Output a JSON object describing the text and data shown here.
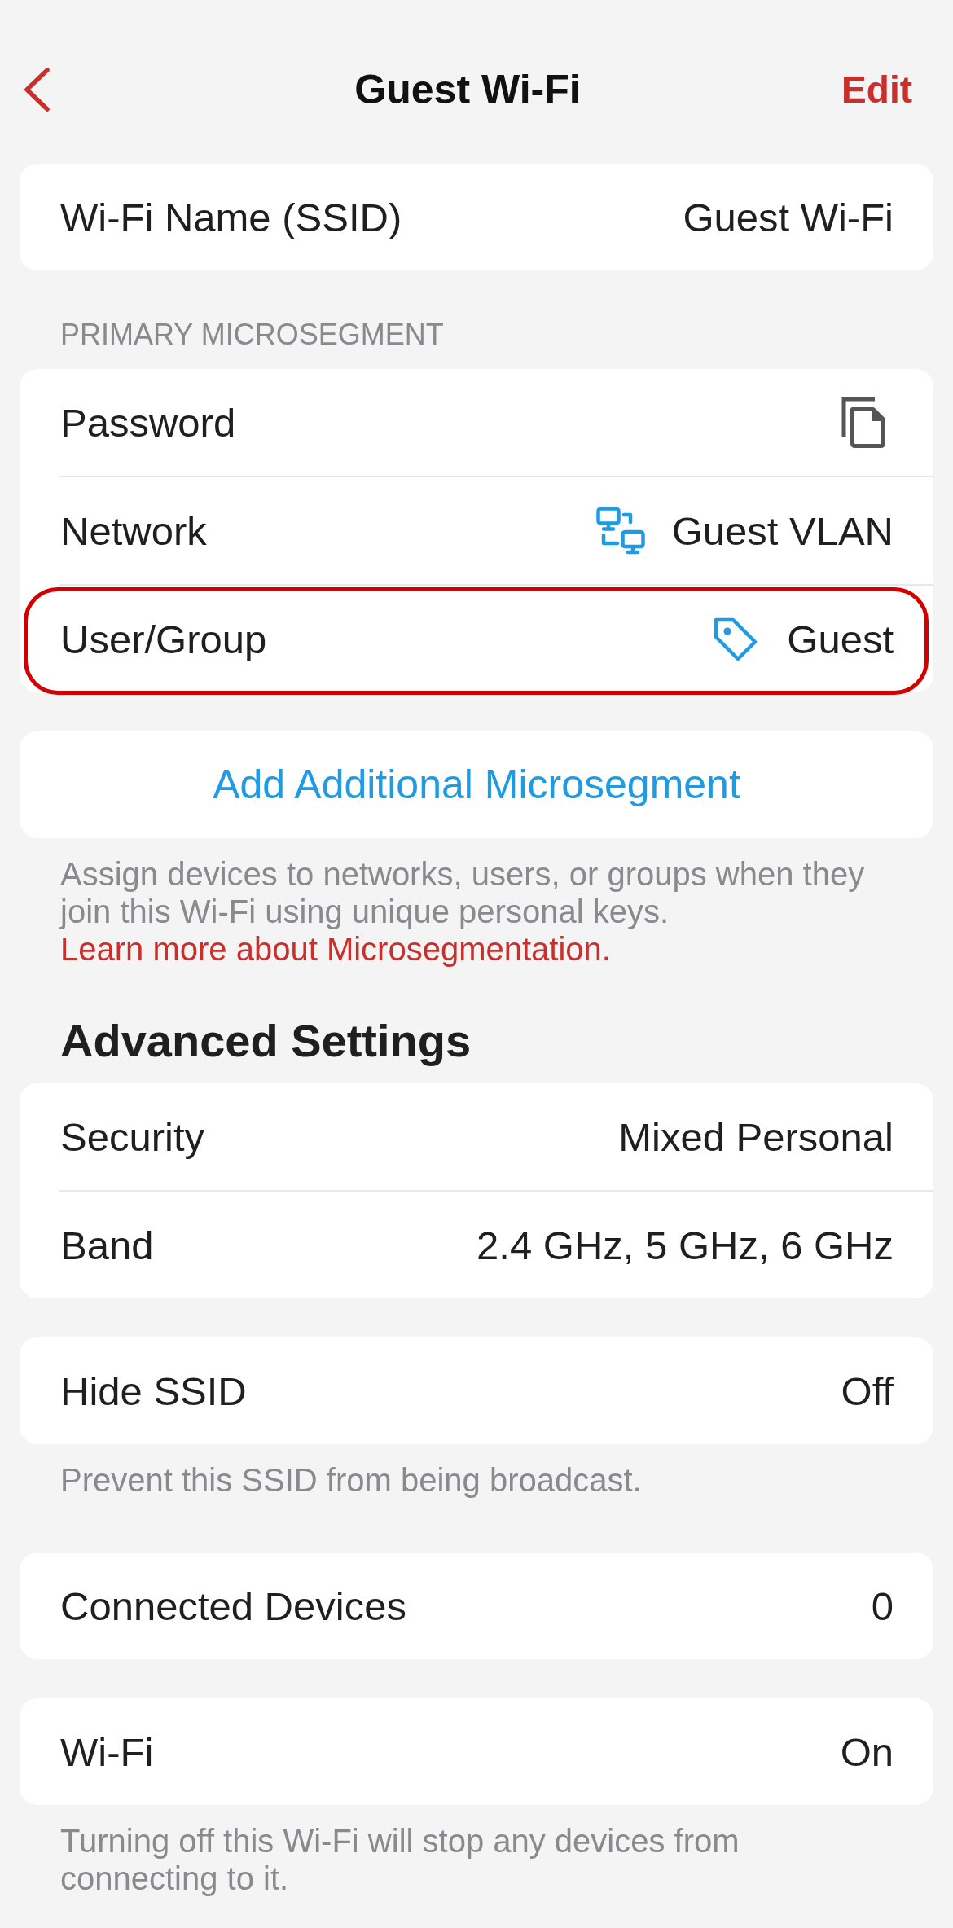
{
  "nav": {
    "title": "Guest Wi-Fi",
    "action": "Edit"
  },
  "sections": [
    {
      "rows": [
        {
          "kind": "value",
          "label": "Wi-Fi Name (SSID)",
          "value": "Guest Wi-Fi",
          "highlighted": false
        }
      ]
    },
    {
      "header": "PRIMARY MICROSEGMENT",
      "rows": [
        {
          "kind": "copy",
          "label": "Password",
          "highlighted": false
        },
        {
          "kind": "network",
          "label": "Network",
          "value": "Guest VLAN",
          "highlighted": false
        },
        {
          "kind": "tag",
          "label": "User/Group",
          "value": "Guest",
          "highlighted": true
        }
      ]
    },
    {
      "rows": [
        {
          "kind": "action",
          "label": "Add Additional Microsegment",
          "highlighted": false
        }
      ],
      "footer": {
        "text": "Assign devices to networks, users, or groups when they join this Wi-Fi using unique personal keys.",
        "link": "Learn more about Microsegmentation."
      }
    },
    {
      "title": "Advanced Settings",
      "rows": [
        {
          "kind": "value",
          "label": "Security",
          "value": "Mixed Personal",
          "highlighted": false
        },
        {
          "kind": "value",
          "label": "Band",
          "value": "2.4 GHz, 5 GHz, 6 GHz",
          "highlighted": false
        }
      ]
    },
    {
      "rows": [
        {
          "kind": "value",
          "label": "Hide SSID",
          "value": "Off",
          "highlighted": false
        }
      ],
      "footer": {
        "text": "Prevent this SSID from being broadcast."
      }
    },
    {
      "rows": [
        {
          "kind": "value",
          "label": "Connected Devices",
          "value": "0",
          "highlighted": false
        }
      ]
    },
    {
      "rows": [
        {
          "kind": "value",
          "label": "Wi-Fi",
          "value": "On",
          "highlighted": false
        }
      ],
      "footer": {
        "text": "Turning off this Wi-Fi will stop any devices from connecting to it."
      }
    }
  ]
}
